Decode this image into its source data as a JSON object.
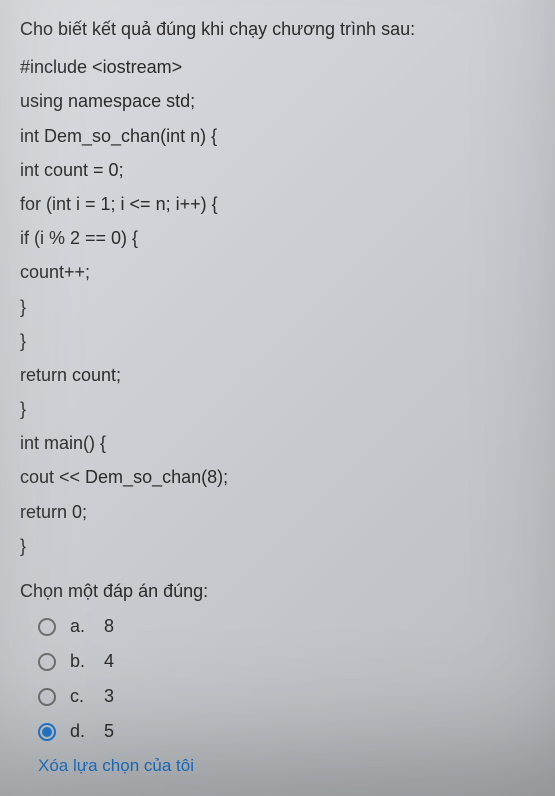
{
  "question": "Cho biết kết quả đúng khi chạy chương trình sau:",
  "code": [
    "#include <iostream>",
    "using namespace std;",
    "int Dem_so_chan(int n) {",
    "int count = 0;",
    "for (int i = 1; i <= n; i++) {",
    "if (i % 2 == 0) {",
    "count++;",
    "}",
    "}",
    "return count;",
    "}",
    "int main() {",
    "cout << Dem_so_chan(8);",
    "return 0;",
    "}"
  ],
  "prompt": "Chọn một đáp án đúng:",
  "options": [
    {
      "letter": "a.",
      "text": "8",
      "selected": false
    },
    {
      "letter": "b.",
      "text": "4",
      "selected": false
    },
    {
      "letter": "c.",
      "text": "3",
      "selected": false
    },
    {
      "letter": "d.",
      "text": "5",
      "selected": true
    }
  ],
  "clear_label": "Xóa lựa chọn của tôi"
}
